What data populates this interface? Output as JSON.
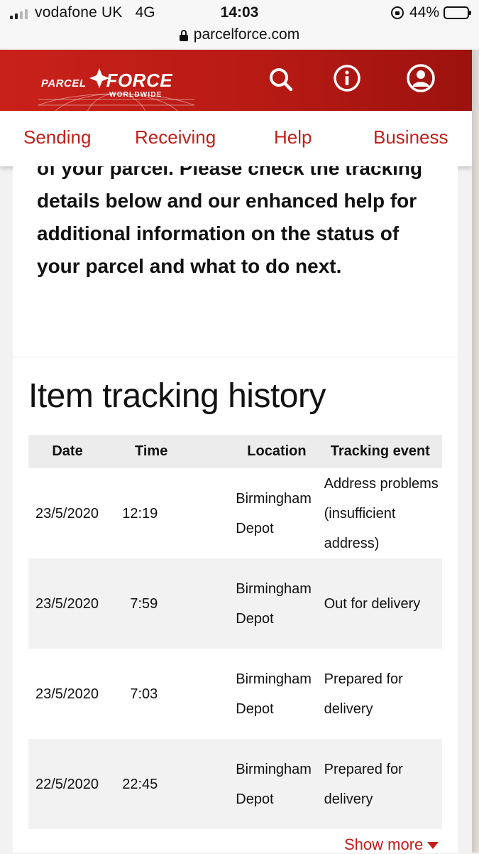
{
  "status_bar": {
    "carrier": "vodafone UK",
    "network": "4G",
    "time": "14:03",
    "battery": "44%",
    "battery_level": 0.44,
    "signal_bars": 2
  },
  "browser": {
    "url": "parcelforce.com"
  },
  "header": {
    "logo_parcel": "PARCEL",
    "logo_force": "FORCE",
    "logo_sub": "WORLDWIDE",
    "brand_color": "#c8211a"
  },
  "nav": {
    "items": [
      "Sending",
      "Receiving",
      "Help",
      "Business"
    ]
  },
  "intro": {
    "text_cut": "of your parcel. Please check the",
    "text": "tracking details below and our enhanced help for additional information on the status of your parcel and what to do next."
  },
  "tracking": {
    "title": "Item tracking history",
    "columns": [
      "Date",
      "Time",
      "Location",
      "Tracking event"
    ],
    "rows": [
      {
        "date": "23/5/2020",
        "time": "12:19",
        "location": "Birmingham Depot",
        "event": "Address problems (insufficient address)"
      },
      {
        "date": "23/5/2020",
        "time": "7:59",
        "location": "Birmingham Depot",
        "event": "Out for delivery"
      },
      {
        "date": "23/5/2020",
        "time": "7:03",
        "location": "Birmingham Depot",
        "event": "Prepared for delivery"
      },
      {
        "date": "22/5/2020",
        "time": "22:45",
        "location": "Birmingham Depot",
        "event": "Prepared for delivery"
      }
    ],
    "show_more": "Show more"
  }
}
